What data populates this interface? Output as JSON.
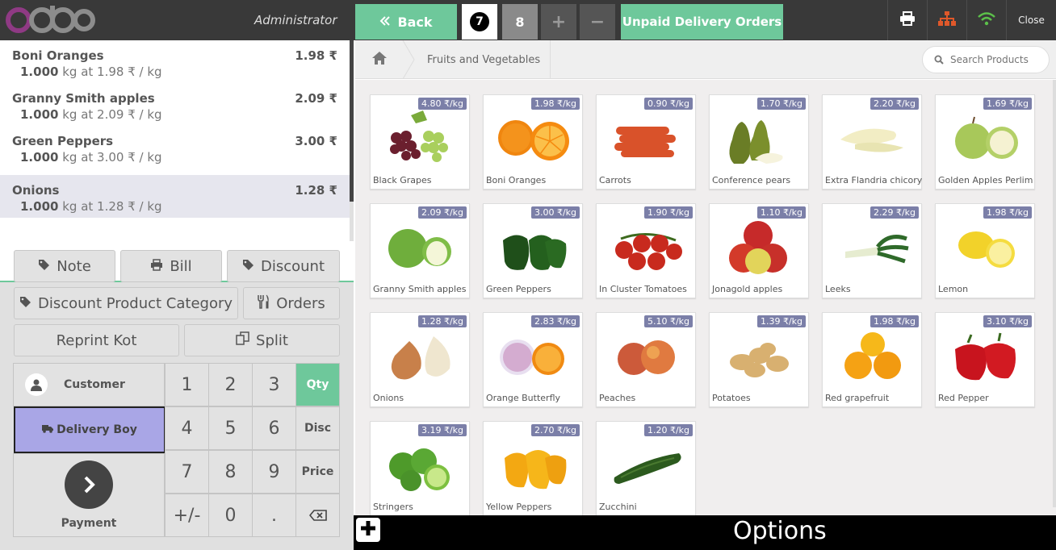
{
  "header": {
    "username": "Administrator",
    "back_label": "Back",
    "order_tabs": [
      "7",
      "8"
    ],
    "unpaid_label": "Unpaid Delivery Orders",
    "close_label": "Close"
  },
  "orderlines": [
    {
      "name": "Boni Oranges",
      "price": "1.98 ₹",
      "qty": "1.000",
      "info": "kg at 1.98 ₹ / kg"
    },
    {
      "name": "Granny Smith apples",
      "price": "2.09 ₹",
      "qty": "1.000",
      "info": "kg at 2.09 ₹ / kg"
    },
    {
      "name": "Green Peppers",
      "price": "3.00 ₹",
      "qty": "1.000",
      "info": "kg at 3.00 ₹ / kg"
    },
    {
      "name": "Onions",
      "price": "1.28 ₹",
      "qty": "1.000",
      "info": "kg at 1.28 ₹ / kg"
    }
  ],
  "control_buttons": {
    "note": "Note",
    "bill": "Bill",
    "discount": "Discount",
    "discount_category": "Discount Product Category",
    "orders": "Orders",
    "reprint": "Reprint Kot",
    "split": "Split"
  },
  "actionpad": {
    "customer": "Customer",
    "delivery": "Delivery Boy",
    "payment": "Payment"
  },
  "numpad": {
    "keys": [
      "1",
      "2",
      "3",
      "4",
      "5",
      "6",
      "7",
      "8",
      "9",
      "+/-",
      "0",
      "."
    ],
    "modes": [
      "Qty",
      "Disc",
      "Price"
    ]
  },
  "category": {
    "breadcrumb": "Fruits and Vegetables",
    "search_placeholder": "Search Products"
  },
  "products": [
    {
      "name": "Black Grapes",
      "price": "4.80 ₹/kg"
    },
    {
      "name": "Boni Oranges",
      "price": "1.98 ₹/kg"
    },
    {
      "name": "Carrots",
      "price": "0.90 ₹/kg"
    },
    {
      "name": "Conference pears",
      "price": "1.70 ₹/kg"
    },
    {
      "name": "Extra Flandria chicory",
      "price": "2.20 ₹/kg"
    },
    {
      "name": "Golden Apples Perlim",
      "price": "1.69 ₹/kg"
    },
    {
      "name": "Granny Smith apples",
      "price": "2.09 ₹/kg"
    },
    {
      "name": "Green Peppers",
      "price": "3.00 ₹/kg"
    },
    {
      "name": "In Cluster Tomatoes",
      "price": "1.90 ₹/kg"
    },
    {
      "name": "Jonagold apples",
      "price": "1.10 ₹/kg"
    },
    {
      "name": "Leeks",
      "price": "2.29 ₹/kg"
    },
    {
      "name": "Lemon",
      "price": "1.98 ₹/kg"
    },
    {
      "name": "Onions",
      "price": "1.28 ₹/kg"
    },
    {
      "name": "Orange Butterfly",
      "price": "2.83 ₹/kg"
    },
    {
      "name": "Peaches",
      "price": "5.10 ₹/kg"
    },
    {
      "name": "Potatoes",
      "price": "1.39 ₹/kg"
    },
    {
      "name": "Red grapefruit",
      "price": "1.98 ₹/kg"
    },
    {
      "name": "Red Pepper",
      "price": "3.10 ₹/kg"
    },
    {
      "name": "Stringers",
      "price": "3.19 ₹/kg"
    },
    {
      "name": "Yellow Peppers",
      "price": "2.70 ₹/kg"
    },
    {
      "name": "Zucchini",
      "price": "1.20 ₹/kg"
    }
  ],
  "options": {
    "label": "Options"
  },
  "colors": {
    "accent": "#6ec89b",
    "header": "#393939",
    "price_tag": "#7b7fa8",
    "delivery": "#a9a6e6"
  }
}
